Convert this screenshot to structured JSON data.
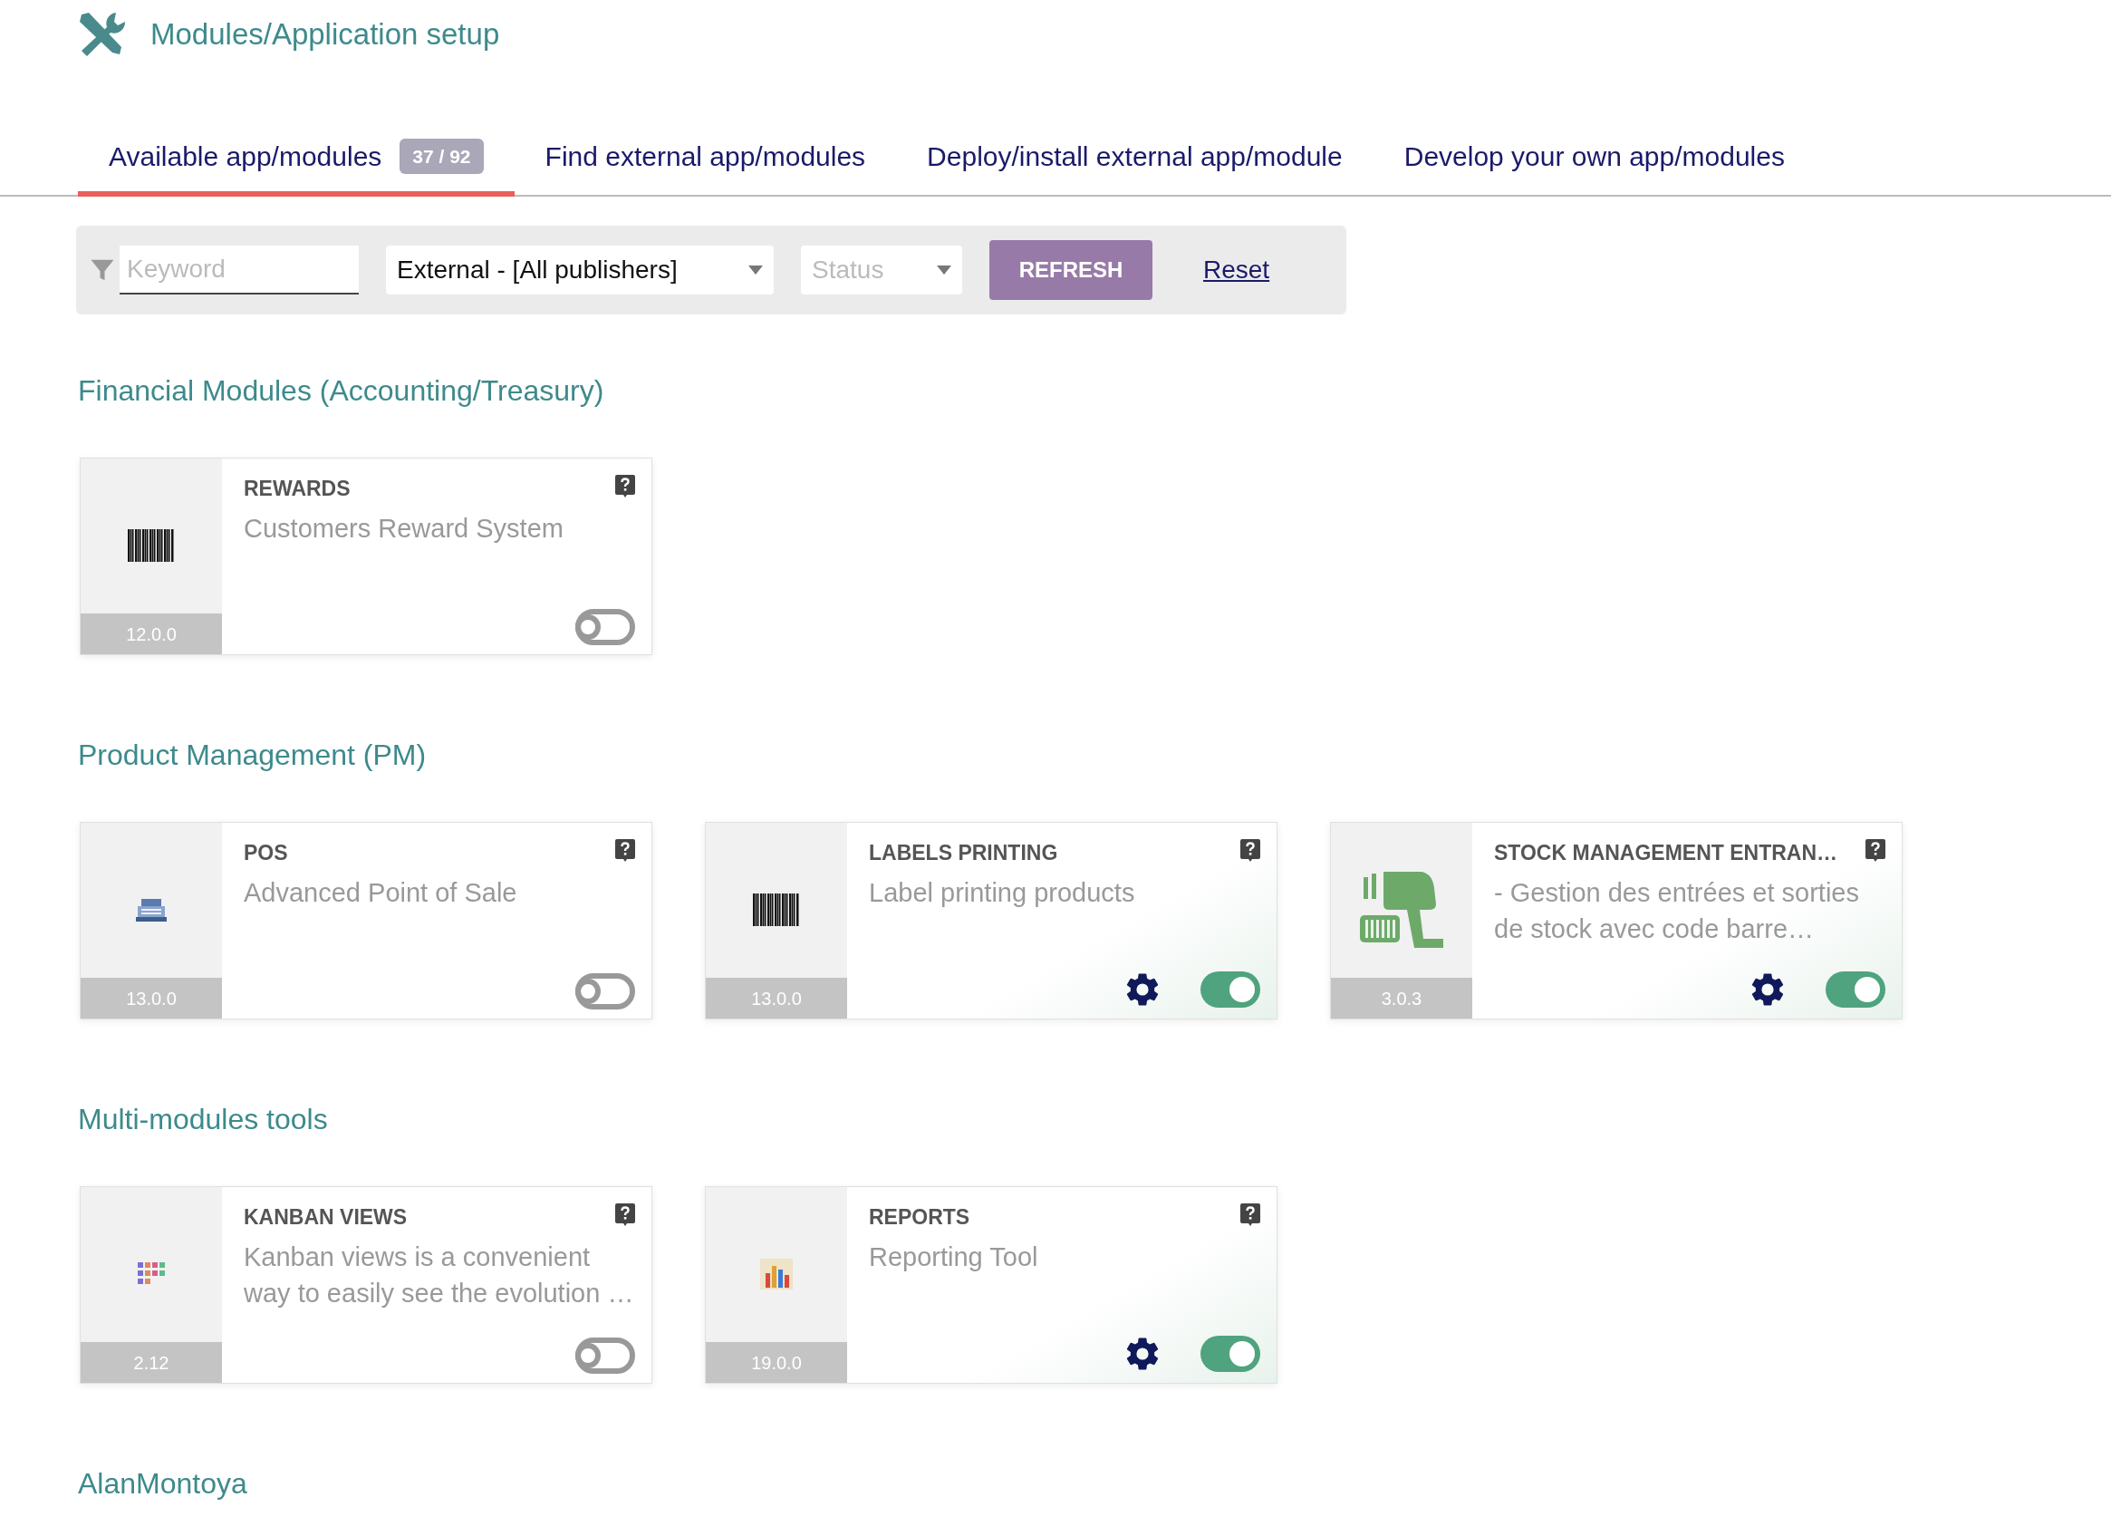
{
  "page": {
    "title": "Modules/Application setup"
  },
  "tabs": [
    {
      "label": "Available app/modules",
      "badge": "37 / 92",
      "selected": true
    },
    {
      "label": "Find external app/modules",
      "selected": false
    },
    {
      "label": "Deploy/install external app/module",
      "selected": false
    },
    {
      "label": "Develop your own app/modules",
      "selected": false
    }
  ],
  "filters": {
    "keyword": {
      "placeholder": "Keyword"
    },
    "publisher": {
      "value": "External - [All publishers]"
    },
    "status": {
      "placeholder": "Status"
    },
    "refresh_button": "REFRESH",
    "reset_link": "Reset"
  },
  "sections": [
    {
      "title": "Financial Modules (Accounting/Treasury)",
      "modules": [
        {
          "name": "REWARDS",
          "description": "Customers Reward System",
          "version": "12.0.0",
          "kind": "barcode",
          "enabled": false
        }
      ]
    },
    {
      "title": "Product Management (PM)",
      "modules": [
        {
          "name": "POS",
          "description": "Advanced Point of Sale",
          "version": "13.0.0",
          "kind": "register",
          "enabled": false
        },
        {
          "name": "LABELS PRINTING",
          "description": "Label printing products",
          "version": "13.0.0",
          "kind": "barcode",
          "enabled": true
        },
        {
          "name": "STOCK MANAGEMENT ENTRAN…",
          "description": "- Gestion des entrées et sorties de stock avec code barre…",
          "version": "3.0.3",
          "kind": "scanner",
          "enabled": true
        }
      ]
    },
    {
      "title": "Multi-modules tools",
      "modules": [
        {
          "name": "KANBAN VIEWS",
          "description": "Kanban views is a convenient way to easily see the evolution …",
          "version": "2.12",
          "kind": "kanban",
          "enabled": false
        },
        {
          "name": "REPORTS",
          "description": "Reporting Tool",
          "version": "19.0.0",
          "kind": "chart",
          "enabled": true
        }
      ]
    },
    {
      "title": "AlanMontoya"
    }
  ]
}
